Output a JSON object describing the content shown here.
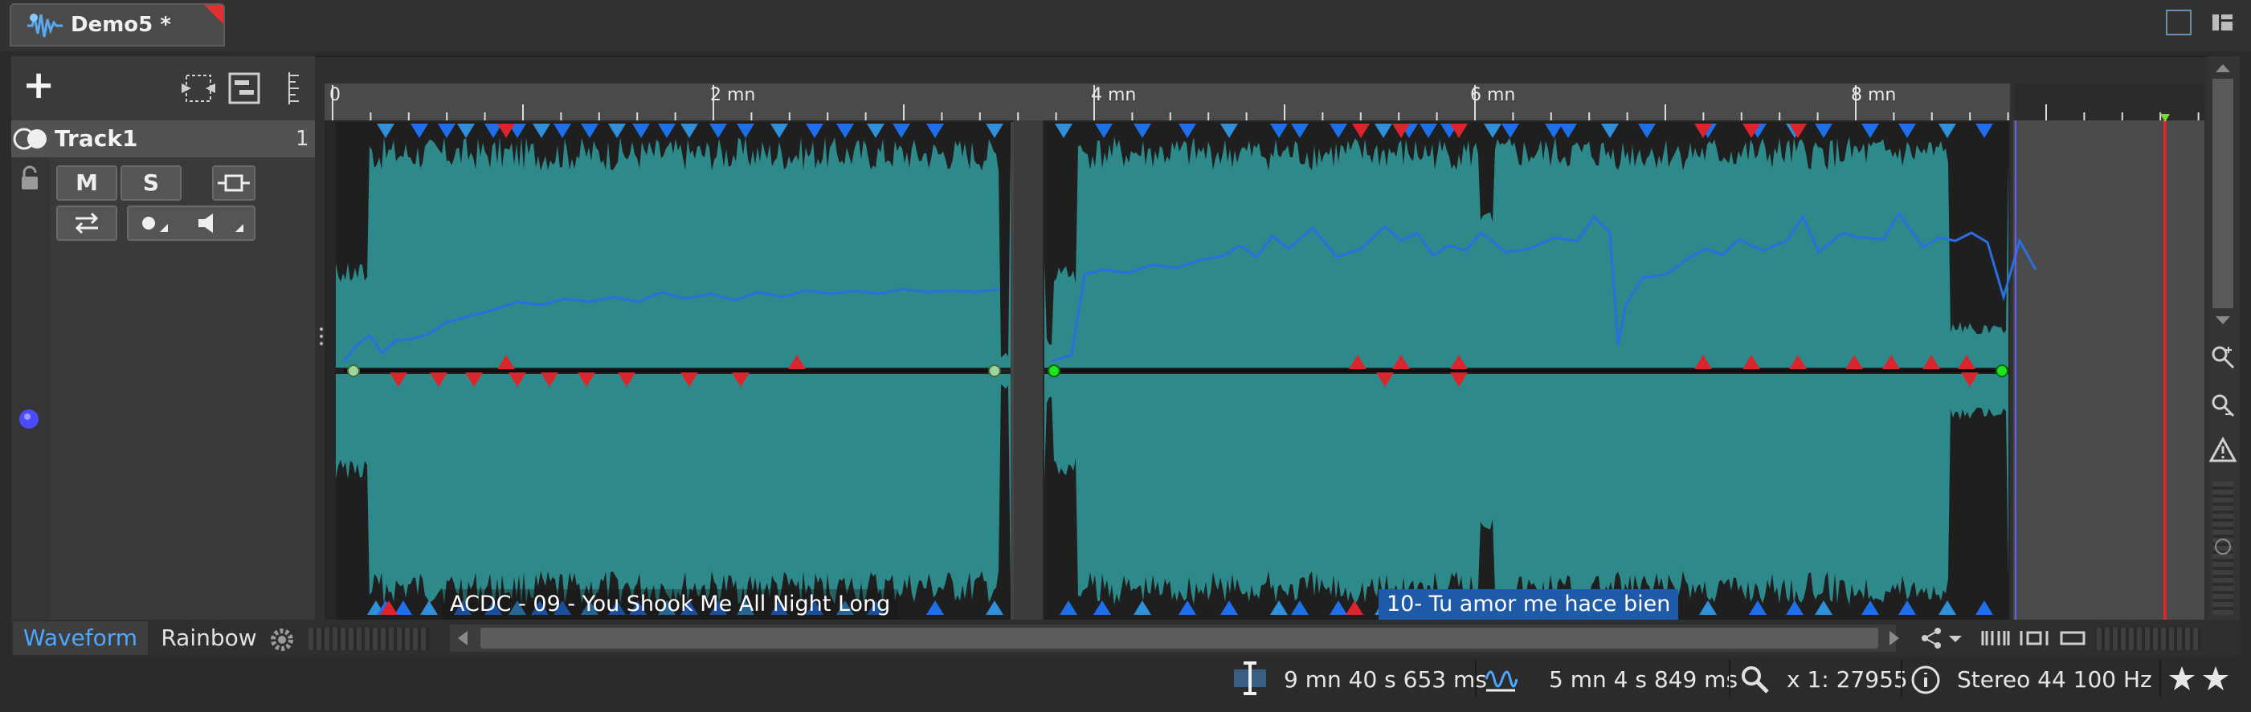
{
  "window": {
    "doc_title": "Demo5 *"
  },
  "toolbar": {
    "add_label": "+"
  },
  "track": {
    "name": "Track1",
    "number": "1",
    "mute_label": "M",
    "solo_label": "S"
  },
  "ruler": {
    "labels": [
      "0",
      "2 mn",
      "4 mn",
      "6 mn",
      "8 mn"
    ]
  },
  "clips": [
    {
      "name": "ACDC - 09 - You Shook Me All Night Long"
    },
    {
      "name": "10- Tu amor me hace bien"
    }
  ],
  "view_tabs": {
    "waveform": "Waveform",
    "rainbow": "Rainbow"
  },
  "status": {
    "cursor_position": "9 mn 40 s 653 ms",
    "selection_length": "5 mn 4 s 849 ms",
    "zoom": "x 1: 27955",
    "format": "Stereo 44 100 Hz"
  },
  "colors": {
    "waveform": "#2e8a8a",
    "envelope": "#2a6fe0",
    "marker_blue": "#1f6fe8",
    "marker_red": "#d8262c",
    "playhead": "#e0262c",
    "accent": "#4da6ff"
  }
}
